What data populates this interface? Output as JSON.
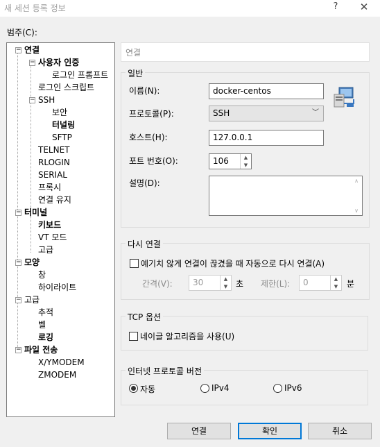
{
  "window": {
    "title": "새 세션 등록 정보",
    "help": "?",
    "close": "✕"
  },
  "category_label": "범주(C):",
  "tree": [
    {
      "label": "연결",
      "bold": true,
      "box": "−"
    },
    {
      "label": "사용자 인증",
      "bold": true,
      "box": "−"
    },
    {
      "label": "로그인 프롬프트",
      "bold": false
    },
    {
      "label": "로그인 스크립트",
      "bold": false
    },
    {
      "label": "SSH",
      "bold": false,
      "box": "−"
    },
    {
      "label": "보안",
      "bold": false
    },
    {
      "label": "터널링",
      "bold": true
    },
    {
      "label": "SFTP",
      "bold": false
    },
    {
      "label": "TELNET",
      "bold": false
    },
    {
      "label": "RLOGIN",
      "bold": false
    },
    {
      "label": "SERIAL",
      "bold": false
    },
    {
      "label": "프록시",
      "bold": false
    },
    {
      "label": "연결 유지",
      "bold": false
    },
    {
      "label": "터미널",
      "bold": true,
      "box": "−"
    },
    {
      "label": "키보드",
      "bold": true
    },
    {
      "label": "VT 모드",
      "bold": false
    },
    {
      "label": "고급",
      "bold": false
    },
    {
      "label": "모양",
      "bold": true,
      "box": "−"
    },
    {
      "label": "창",
      "bold": false
    },
    {
      "label": "하이라이트",
      "bold": false
    },
    {
      "label": "고급",
      "bold": false,
      "box": "−"
    },
    {
      "label": "추적",
      "bold": false
    },
    {
      "label": "벨",
      "bold": false
    },
    {
      "label": "로깅",
      "bold": true
    },
    {
      "label": "파일 전송",
      "bold": true,
      "box": "−"
    },
    {
      "label": "X/YMODEM",
      "bold": false
    },
    {
      "label": "ZMODEM",
      "bold": false
    }
  ],
  "header": "연결",
  "general": {
    "title": "일반",
    "name_label": "이름(N):",
    "name_value": "docker-centos",
    "protocol_label": "프로토콜(P):",
    "protocol_value": "SSH",
    "host_label": "호스트(H):",
    "host_value": "127.0.0.1",
    "port_label": "포트 번호(O):",
    "port_value": "106",
    "desc_label": "설명(D):",
    "desc_value": ""
  },
  "reconnect": {
    "title": "다시 연결",
    "checkbox_label": "예기치 않게 연결이 끊겼을 때 자동으로 다시 연결(A)",
    "interval_label": "간격(V):",
    "interval_value": "30",
    "interval_unit": "초",
    "limit_label": "제한(L):",
    "limit_value": "0",
    "limit_unit": "분"
  },
  "tcp": {
    "title": "TCP 옵션",
    "checkbox_label": "네이글 알고리즘을 사용(U)"
  },
  "ip_version": {
    "title": "인터넷 프로토콜 버전",
    "options": [
      "자동",
      "IPv4",
      "IPv6"
    ],
    "selected": "자동"
  },
  "buttons": {
    "connect": "연결",
    "ok": "확인",
    "cancel": "취소"
  },
  "colors": {
    "accent": "#0078d7",
    "tree_border": "#7a7a7a"
  }
}
